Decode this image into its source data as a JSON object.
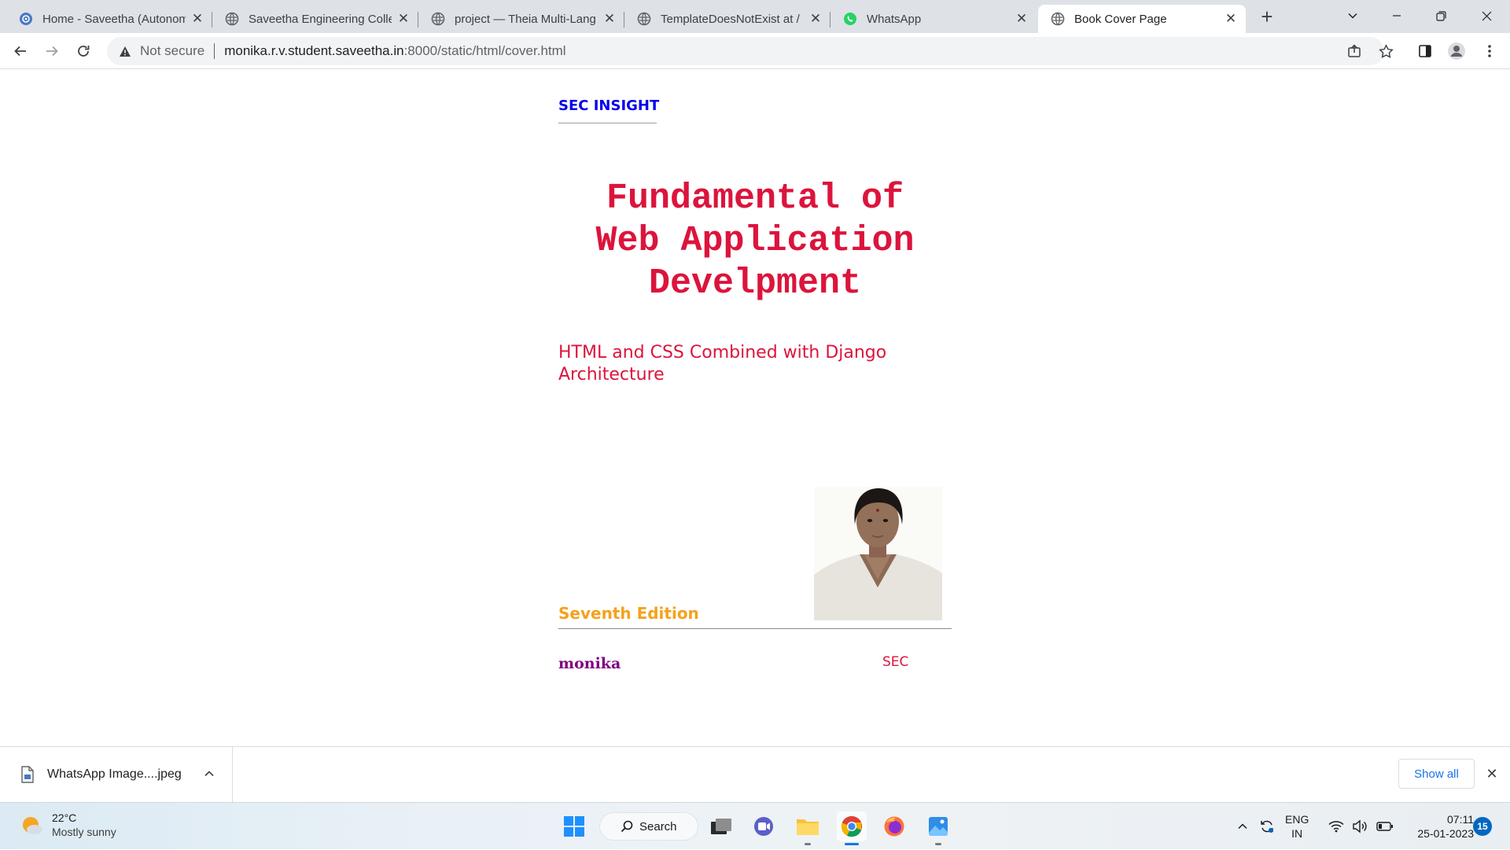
{
  "browser": {
    "tabs": [
      {
        "title": "Home - Saveetha (Autonom",
        "favicon": "saveetha-logo-icon"
      },
      {
        "title": "Saveetha Engineering Colle",
        "favicon": "globe-icon"
      },
      {
        "title": "project — Theia Multi-Lang",
        "favicon": "globe-icon"
      },
      {
        "title": "TemplateDoesNotExist at /",
        "favicon": "globe-icon"
      },
      {
        "title": "WhatsApp",
        "favicon": "whatsapp-icon"
      },
      {
        "title": "Book Cover Page",
        "favicon": "globe-icon",
        "active": true
      }
    ],
    "address_bar": {
      "security_label": "Not secure",
      "host": "monika.r.v.student.saveetha.in",
      "path": ":8000/static/html/cover.html"
    }
  },
  "page": {
    "brand": "SEC INSIGHT",
    "title_lines": [
      "Fundamental of",
      "Web Application",
      "Develpment"
    ],
    "subtitle": "HTML and CSS Combined with Django Architecture",
    "edition": "Seventh Edition",
    "author": "monika",
    "publisher": "SEC",
    "colors": {
      "brand": "#0000ee",
      "title": "#dc143c",
      "edition": "#f4a21c",
      "author": "#800080"
    }
  },
  "downloads": {
    "file_name": "WhatsApp Image....jpeg",
    "show_all_label": "Show all"
  },
  "taskbar": {
    "weather": {
      "temperature": "22°C",
      "condition": "Mostly sunny"
    },
    "search_label": "Search",
    "apps": [
      "windows-start-icon",
      "task-view-icon",
      "teams-chat-icon",
      "file-explorer-icon",
      "chrome-icon",
      "firefox-icon",
      "photos-icon"
    ],
    "language": {
      "line1": "ENG",
      "line2": "IN"
    },
    "clock": {
      "time": "07:11",
      "date": "25-01-2023"
    },
    "notification_count": "15"
  }
}
